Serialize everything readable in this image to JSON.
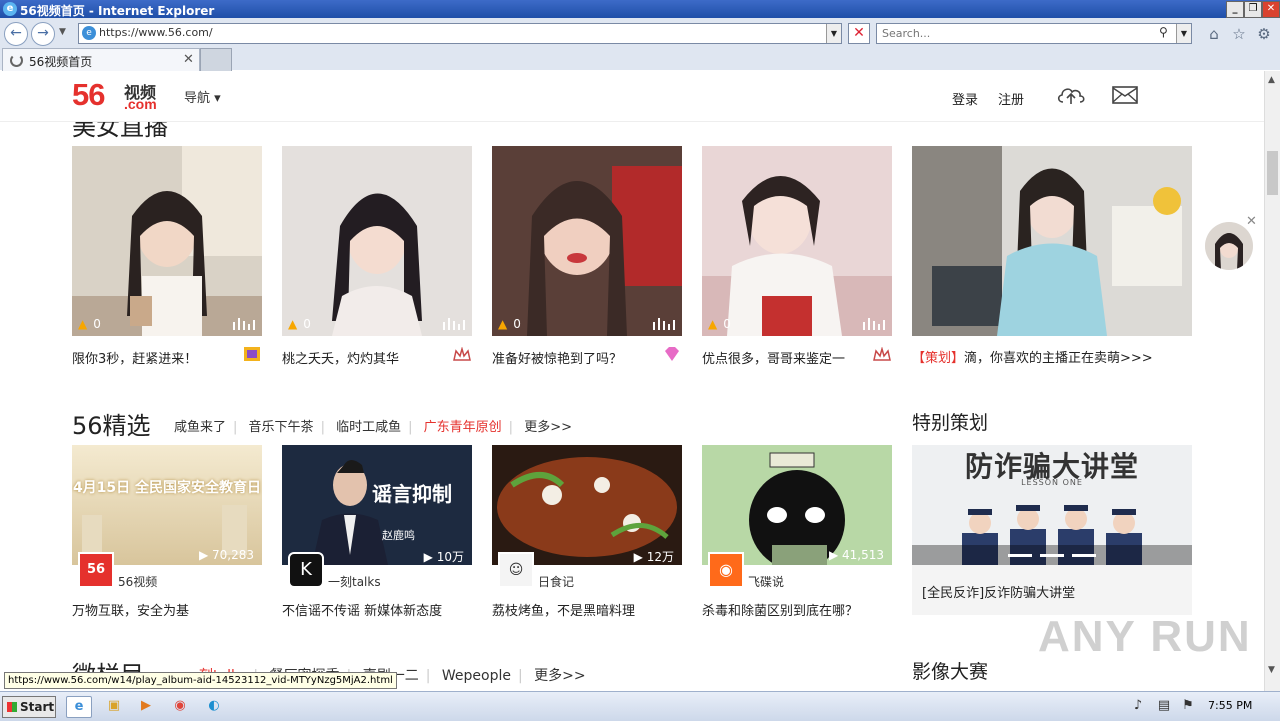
{
  "browser": {
    "title": "56视频首页 - Internet Explorer",
    "address": "https://www.56.com/",
    "search_placeholder": "Search...",
    "tab_label": "56视频首页"
  },
  "header": {
    "logo_num": "56",
    "logo_cn": "视频",
    "logo_com": ".com",
    "nav": "导航 ▾",
    "login": "登录",
    "register": "注册"
  },
  "live": {
    "section_title": "美女直播",
    "cards": [
      {
        "count": "0",
        "title": "限你3秒，赶紧进来！"
      },
      {
        "count": "0",
        "title": "桃之夭夭，灼灼其华"
      },
      {
        "count": "0",
        "title": "准备好被惊艳到了吗？"
      },
      {
        "count": "0",
        "title": "优点很多，哥哥来鉴定一"
      }
    ],
    "promo": {
      "tag": "【策划】",
      "text": "滴，你喜欢的主播正在卖萌>>>"
    }
  },
  "featured": {
    "section_title": "56精选",
    "tabs": [
      "咸鱼来了",
      "音乐下午茶",
      "临时工咸鱼",
      "广东青年原创",
      "更多>>"
    ],
    "videos": [
      {
        "plays": "70,283",
        "author": "56视频",
        "title": "万物互联，安全为基",
        "overlay": "4月15日 全民国家安全教育日"
      },
      {
        "plays": "10万",
        "author": "一刻talks",
        "title": "不信谣不传谣 新媒体新态度",
        "overlay": "谣言抑制",
        "person": "赵鹿鸣"
      },
      {
        "plays": "12万",
        "author": "日食记",
        "title": "荔枝烤鱼，不是黑暗料理"
      },
      {
        "plays": "41,513",
        "author": "飞碟说",
        "title": "杀毒和除菌区别到底在哪？"
      }
    ]
  },
  "special": {
    "section_title": "特别策划",
    "banner_title": "防诈骗大讲堂",
    "banner_sub": "LESSON ONE",
    "caption": "[全民反诈]反诈防骗大讲堂"
  },
  "micro": {
    "section_title": "微栏目",
    "tabs": [
      "一刻talks",
      "餐厅密探季",
      "壹剧一二",
      "Wepeople",
      "更多>>"
    ]
  },
  "contest": {
    "section_title": "影像大赛"
  },
  "status_url": "https://www.56.com/w14/play_album-aid-14523112_vid-MTYyNzg5MjA2.html",
  "watermark": "ANY RUN",
  "taskbar": {
    "start": "Start",
    "clock": "7:55 PM"
  },
  "colors": {
    "brand_red": "#e5312d",
    "hot_tab": "#e5312d",
    "promo_tag": "#e5312d"
  }
}
